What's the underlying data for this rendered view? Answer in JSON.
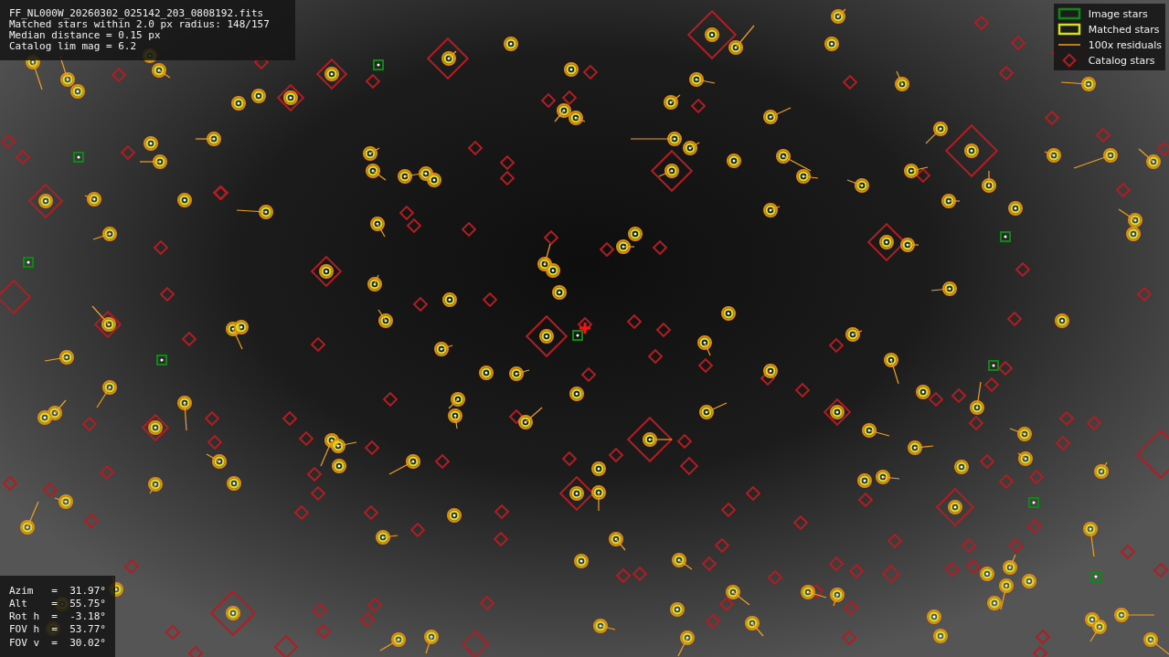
{
  "info_panel": {
    "lines": [
      "FF_NL000W_20260302_025142_203_0808192.fits",
      "Matched stars within 2.0 px radius: 148/157",
      "Median distance = 0.15 px",
      "Catalog lim mag = 6.2"
    ]
  },
  "legend": [
    {
      "kind": "image",
      "label": "Image stars"
    },
    {
      "kind": "matched",
      "label": "Matched stars"
    },
    {
      "kind": "residual",
      "label": "100x residuals"
    },
    {
      "kind": "catalog",
      "label": "Catalog stars"
    }
  ],
  "pointing_panel": {
    "lines": [
      "Azim   =  31.97°",
      "Alt    =  55.75°",
      "Rot h  =  -3.18°",
      "FOV h  =  53.77°",
      "FOV v  =  30.02°"
    ]
  }
}
